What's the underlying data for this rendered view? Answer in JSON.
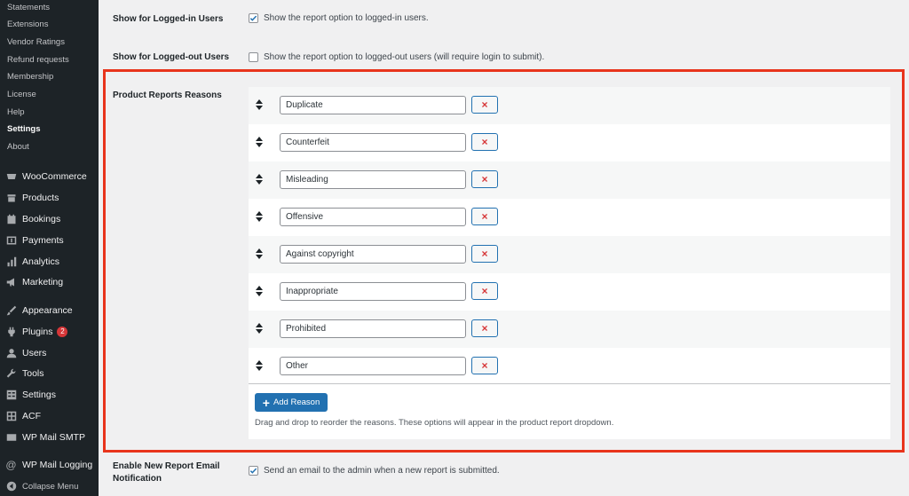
{
  "sidebar": {
    "submenu": [
      {
        "label": "Statements",
        "current": false
      },
      {
        "label": "Extensions",
        "current": false
      },
      {
        "label": "Vendor Ratings",
        "current": false
      },
      {
        "label": "Refund requests",
        "current": false
      },
      {
        "label": "Membership",
        "current": false
      },
      {
        "label": "License",
        "current": false
      },
      {
        "label": "Help",
        "current": false
      },
      {
        "label": "Settings",
        "current": true
      },
      {
        "label": "About",
        "current": false
      }
    ],
    "menu": [
      {
        "label": "WooCommerce",
        "icon": "woocommerce-icon"
      },
      {
        "label": "Products",
        "icon": "products-icon"
      },
      {
        "label": "Bookings",
        "icon": "calendar-icon"
      },
      {
        "label": "Payments",
        "icon": "dollar-icon"
      },
      {
        "label": "Analytics",
        "icon": "bar-chart-icon"
      },
      {
        "label": "Marketing",
        "icon": "megaphone-icon"
      },
      {
        "label": "Appearance",
        "icon": "paintbrush-icon"
      },
      {
        "label": "Plugins",
        "icon": "plugin-icon",
        "badge": "2"
      },
      {
        "label": "Users",
        "icon": "user-icon"
      },
      {
        "label": "Tools",
        "icon": "wrench-icon"
      },
      {
        "label": "Settings",
        "icon": "settings-icon"
      },
      {
        "label": "ACF",
        "icon": "grid-icon"
      },
      {
        "label": "WP Mail SMTP",
        "icon": "envelope-icon"
      },
      {
        "label": "WP Mail Logging",
        "icon": "at-icon"
      }
    ],
    "collapse_label": "Collapse Menu"
  },
  "settings": {
    "logged_in": {
      "label": "Show for Logged-in Users",
      "checkbox_text": "Show the report option to logged-in users.",
      "checked": true
    },
    "logged_out": {
      "label": "Show for Logged-out Users",
      "checkbox_text": "Show the report option to logged-out users (will require login to submit).",
      "checked": false
    },
    "reasons": {
      "label": "Product Reports Reasons",
      "items": [
        "Duplicate",
        "Counterfeit",
        "Misleading",
        "Offensive",
        "Against copyright",
        "Inappropriate",
        "Prohibited",
        "Other"
      ],
      "add_label": "Add Reason",
      "help_text": "Drag and drop to reorder the reasons. These options will appear in the product report dropdown."
    },
    "email_notification": {
      "label_line1": "Enable New Report Email",
      "label_line2": "Notification",
      "checkbox_text": "Send an email to the admin when a new report is submitted.",
      "checked": true
    }
  },
  "colors": {
    "sidebar_bg": "#1d2327",
    "accent": "#2271b1",
    "highlight": "#e8341c",
    "remove": "#d63638"
  }
}
